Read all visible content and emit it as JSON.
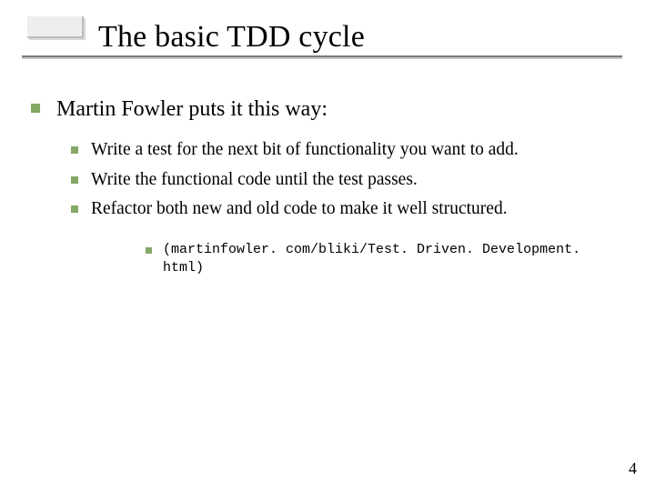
{
  "title": "The basic TDD cycle",
  "level1": "Martin Fowler puts it this way:",
  "level2": [
    "Write a test for the next bit of functionality you want to add.",
    "Write the functional code until the test passes.",
    "Refactor both new and old code to make it well structured."
  ],
  "level3": "(martinfowler. com/bliki/Test. Driven. Development. html)",
  "page_number": "4",
  "colors": {
    "bullet": "#85a866"
  }
}
